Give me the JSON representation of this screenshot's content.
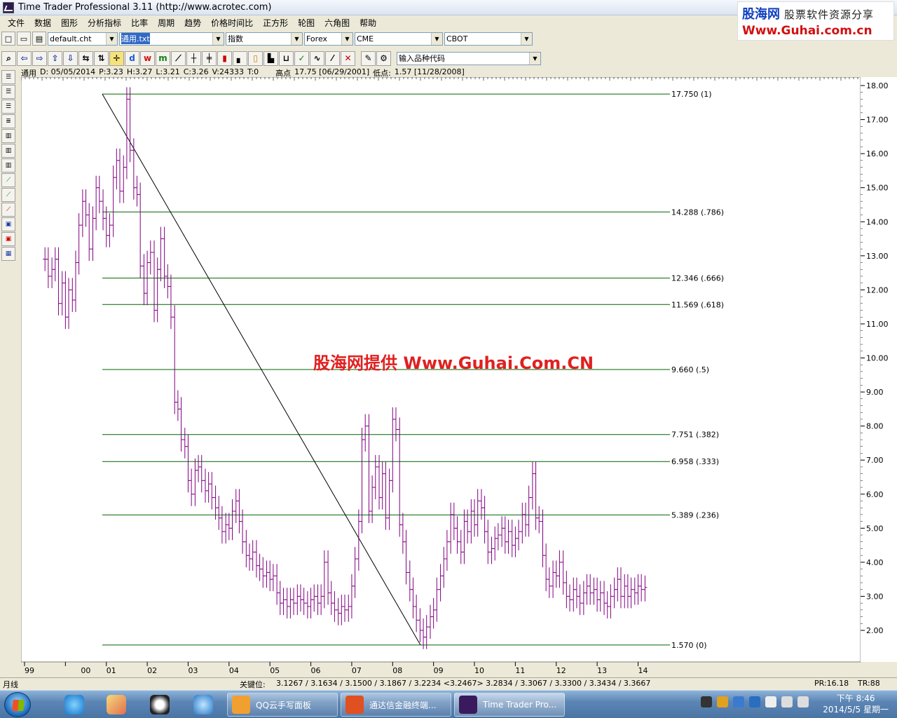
{
  "window": {
    "title": "Time Trader Professional 3.11 (http://www.acrotec.com)"
  },
  "logo": {
    "brand": "股海网",
    "slogan": "股票软件资源分享",
    "url": "Www.Guhai.com.cn"
  },
  "menu": [
    "文件",
    "数据",
    "图形",
    "分析指标",
    "比率",
    "周期",
    "趋势",
    "价格时间比",
    "正方形",
    "轮图",
    "六角图",
    "帮助"
  ],
  "toolbar1": {
    "chart_file": "default.cht",
    "symbol_file": "通用.txt",
    "category": "指数",
    "market1": "Forex",
    "market2": "CME",
    "market3": "CBOT"
  },
  "toolbar2": {
    "symbol_input_placeholder": "输入品种代码"
  },
  "infoline": {
    "name": "通用",
    "date": "D: 05/05/2014",
    "price": "P:3.23",
    "high": "H:3.27",
    "low": "L:3.21",
    "close": "C:3.26",
    "volume": "V:24333",
    "time": "T:0",
    "high_label": "高点",
    "high_value": "17.75 [06/29/2001]",
    "low_label": "低点:",
    "low_value": "1.57 [11/28/2008]"
  },
  "watermark": "股海网提供 Www.Guhai.Com.CN",
  "chart_data": {
    "type": "line",
    "y_range": [
      1.2,
      18.4
    ],
    "y_ticks": [
      "18.00",
      "17.00",
      "16.00",
      "15.00",
      "14.00",
      "13.00",
      "12.00",
      "11.00",
      "10.00",
      "9.00",
      "8.00",
      "7.00",
      "6.00",
      "5.00",
      "4.00",
      "3.00",
      "2.00"
    ],
    "x_ticks": [
      "99",
      "00",
      "01",
      "02",
      "03",
      "04",
      "05",
      "06",
      "07",
      "08",
      "09",
      "10",
      "11",
      "12",
      "13",
      "14"
    ],
    "series_color": "#800080",
    "fib_color": "#006400",
    "fib_levels": [
      {
        "value": 17.75,
        "label": "17.750  (1)"
      },
      {
        "value": 14.288,
        "label": "14.288  (.786)"
      },
      {
        "value": 12.346,
        "label": "12.346  (.666)"
      },
      {
        "value": 11.569,
        "label": "11.569  (.618)"
      },
      {
        "value": 9.66,
        "label": "9.660  (.5)"
      },
      {
        "value": 7.751,
        "label": "7.751  (.382)"
      },
      {
        "value": 6.958,
        "label": "6.958  (.333)"
      },
      {
        "value": 5.389,
        "label": "5.389  (.236)"
      },
      {
        "value": 1.57,
        "label": "1.570  (0)"
      }
    ],
    "high_point": {
      "value": 17.75,
      "date": "06/29/2001"
    },
    "low_point": {
      "value": 1.57,
      "date": "11/28/2008"
    },
    "x_year_values": [
      1999,
      2000,
      2001,
      2002,
      2003,
      2004,
      2005,
      2006,
      2007,
      2008,
      2009,
      2010,
      2011,
      2012,
      2013,
      2014
    ],
    "closes": [
      [
        1999.5,
        12.9
      ],
      [
        1999.58,
        12.4
      ],
      [
        1999.67,
        12.6
      ],
      [
        1999.75,
        12.9
      ],
      [
        1999.83,
        11.6
      ],
      [
        1999.92,
        12.2
      ],
      [
        2000.0,
        11.2
      ],
      [
        2000.08,
        12.0
      ],
      [
        2000.17,
        11.7
      ],
      [
        2000.25,
        12.8
      ],
      [
        2000.33,
        13.9
      ],
      [
        2000.42,
        14.6
      ],
      [
        2000.5,
        14.2
      ],
      [
        2000.58,
        13.2
      ],
      [
        2000.67,
        14.1
      ],
      [
        2000.75,
        15.0
      ],
      [
        2000.83,
        14.6
      ],
      [
        2000.92,
        14.1
      ],
      [
        2001.0,
        13.6
      ],
      [
        2001.08,
        13.9
      ],
      [
        2001.17,
        15.3
      ],
      [
        2001.25,
        15.8
      ],
      [
        2001.33,
        14.9
      ],
      [
        2001.42,
        15.6
      ],
      [
        2001.5,
        17.6
      ],
      [
        2001.58,
        16.1
      ],
      [
        2001.67,
        15.0
      ],
      [
        2001.75,
        14.8
      ],
      [
        2001.83,
        12.7
      ],
      [
        2001.92,
        11.9
      ],
      [
        2002.0,
        12.8
      ],
      [
        2002.08,
        13.1
      ],
      [
        2002.17,
        11.4
      ],
      [
        2002.25,
        12.6
      ],
      [
        2002.33,
        13.5
      ],
      [
        2002.42,
        12.4
      ],
      [
        2002.5,
        12.1
      ],
      [
        2002.58,
        11.2
      ],
      [
        2002.67,
        8.7
      ],
      [
        2002.75,
        8.5
      ],
      [
        2002.83,
        7.6
      ],
      [
        2002.92,
        7.4
      ],
      [
        2003.0,
        6.4
      ],
      [
        2003.08,
        6.0
      ],
      [
        2003.17,
        6.7
      ],
      [
        2003.25,
        6.8
      ],
      [
        2003.33,
        6.4
      ],
      [
        2003.42,
        6.1
      ],
      [
        2003.5,
        6.3
      ],
      [
        2003.58,
        5.9
      ],
      [
        2003.67,
        5.6
      ],
      [
        2003.75,
        5.3
      ],
      [
        2003.83,
        4.9
      ],
      [
        2003.92,
        5.1
      ],
      [
        2004.0,
        5.0
      ],
      [
        2004.08,
        5.5
      ],
      [
        2004.17,
        5.8
      ],
      [
        2004.25,
        5.2
      ],
      [
        2004.33,
        4.6
      ],
      [
        2004.42,
        4.2
      ],
      [
        2004.5,
        4.1
      ],
      [
        2004.58,
        4.3
      ],
      [
        2004.67,
        3.9
      ],
      [
        2004.75,
        3.8
      ],
      [
        2004.83,
        3.6
      ],
      [
        2004.92,
        3.7
      ],
      [
        2005.0,
        3.5
      ],
      [
        2005.08,
        3.6
      ],
      [
        2005.17,
        3.1
      ],
      [
        2005.25,
        2.8
      ],
      [
        2005.33,
        2.9
      ],
      [
        2005.42,
        2.7
      ],
      [
        2005.5,
        2.9
      ],
      [
        2005.58,
        2.8
      ],
      [
        2005.67,
        3.0
      ],
      [
        2005.75,
        2.9
      ],
      [
        2005.83,
        2.8
      ],
      [
        2005.92,
        2.7
      ],
      [
        2006.0,
        2.9
      ],
      [
        2006.08,
        3.0
      ],
      [
        2006.17,
        2.8
      ],
      [
        2006.25,
        3.0
      ],
      [
        2006.33,
        4.0
      ],
      [
        2006.42,
        3.1
      ],
      [
        2006.5,
        2.8
      ],
      [
        2006.58,
        2.6
      ],
      [
        2006.67,
        2.5
      ],
      [
        2006.75,
        2.7
      ],
      [
        2006.83,
        2.6
      ],
      [
        2006.92,
        2.7
      ],
      [
        2007.0,
        3.3
      ],
      [
        2007.08,
        4.1
      ],
      [
        2007.17,
        5.2
      ],
      [
        2007.25,
        7.6
      ],
      [
        2007.33,
        8.0
      ],
      [
        2007.42,
        5.5
      ],
      [
        2007.5,
        6.2
      ],
      [
        2007.58,
        6.8
      ],
      [
        2007.67,
        5.9
      ],
      [
        2007.75,
        6.6
      ],
      [
        2007.83,
        5.3
      ],
      [
        2007.92,
        6.4
      ],
      [
        2008.0,
        8.2
      ],
      [
        2008.08,
        7.9
      ],
      [
        2008.17,
        5.1
      ],
      [
        2008.25,
        4.6
      ],
      [
        2008.33,
        3.7
      ],
      [
        2008.42,
        3.2
      ],
      [
        2008.5,
        2.7
      ],
      [
        2008.58,
        2.3
      ],
      [
        2008.67,
        2.0
      ],
      [
        2008.75,
        1.8
      ],
      [
        2008.83,
        2.1
      ],
      [
        2008.92,
        2.4
      ],
      [
        2009.0,
        2.6
      ],
      [
        2009.08,
        3.2
      ],
      [
        2009.17,
        3.6
      ],
      [
        2009.25,
        4.1
      ],
      [
        2009.33,
        4.6
      ],
      [
        2009.42,
        5.4
      ],
      [
        2009.5,
        5.0
      ],
      [
        2009.58,
        4.6
      ],
      [
        2009.67,
        4.3
      ],
      [
        2009.75,
        5.2
      ],
      [
        2009.83,
        4.9
      ],
      [
        2009.92,
        5.5
      ],
      [
        2010.0,
        5.1
      ],
      [
        2010.08,
        5.8
      ],
      [
        2010.17,
        5.6
      ],
      [
        2010.25,
        4.9
      ],
      [
        2010.33,
        4.3
      ],
      [
        2010.42,
        4.4
      ],
      [
        2010.5,
        4.7
      ],
      [
        2010.58,
        4.8
      ],
      [
        2010.67,
        5.0
      ],
      [
        2010.75,
        4.6
      ],
      [
        2010.83,
        4.9
      ],
      [
        2010.92,
        4.5
      ],
      [
        2011.0,
        4.7
      ],
      [
        2011.08,
        4.9
      ],
      [
        2011.17,
        5.4
      ],
      [
        2011.25,
        5.1
      ],
      [
        2011.33,
        5.9
      ],
      [
        2011.42,
        6.6
      ],
      [
        2011.5,
        5.3
      ],
      [
        2011.58,
        5.2
      ],
      [
        2011.67,
        4.2
      ],
      [
        2011.75,
        3.5
      ],
      [
        2011.83,
        3.3
      ],
      [
        2011.92,
        3.7
      ],
      [
        2012.0,
        3.6
      ],
      [
        2012.08,
        4.0
      ],
      [
        2012.17,
        3.4
      ],
      [
        2012.25,
        3.0
      ],
      [
        2012.33,
        2.9
      ],
      [
        2012.42,
        3.2
      ],
      [
        2012.5,
        3.0
      ],
      [
        2012.58,
        2.8
      ],
      [
        2012.67,
        3.1
      ],
      [
        2012.75,
        3.3
      ],
      [
        2012.83,
        3.1
      ],
      [
        2012.92,
        3.2
      ],
      [
        2013.0,
        2.9
      ],
      [
        2013.08,
        3.1
      ],
      [
        2013.17,
        2.8
      ],
      [
        2013.25,
        2.7
      ],
      [
        2013.33,
        3.0
      ],
      [
        2013.42,
        3.2
      ],
      [
        2013.5,
        3.5
      ],
      [
        2013.58,
        3.0
      ],
      [
        2013.67,
        3.3
      ],
      [
        2013.75,
        3.0
      ],
      [
        2013.83,
        3.2
      ],
      [
        2013.92,
        3.1
      ],
      [
        2014.0,
        3.3
      ],
      [
        2014.08,
        3.2
      ],
      [
        2014.17,
        3.26
      ]
    ]
  },
  "statusbar": {
    "period": "月线",
    "key_label": "关键位:",
    "key_values": "3.1267 / 3.1634 / 3.1500 / 3.1867 / 3.2234 <3.2467> 3.2834 / 3.3067 / 3.3300 / 3.3434 / 3.3667",
    "pr": "PR:16.18",
    "tr": "TR:88"
  },
  "taskbar": {
    "tasks": [
      "QQ云手写面板",
      "通达信金融终端...",
      "Time Trader Pro..."
    ],
    "clock_time": "下午 8:46",
    "clock_date": "2014/5/5 星期一"
  }
}
